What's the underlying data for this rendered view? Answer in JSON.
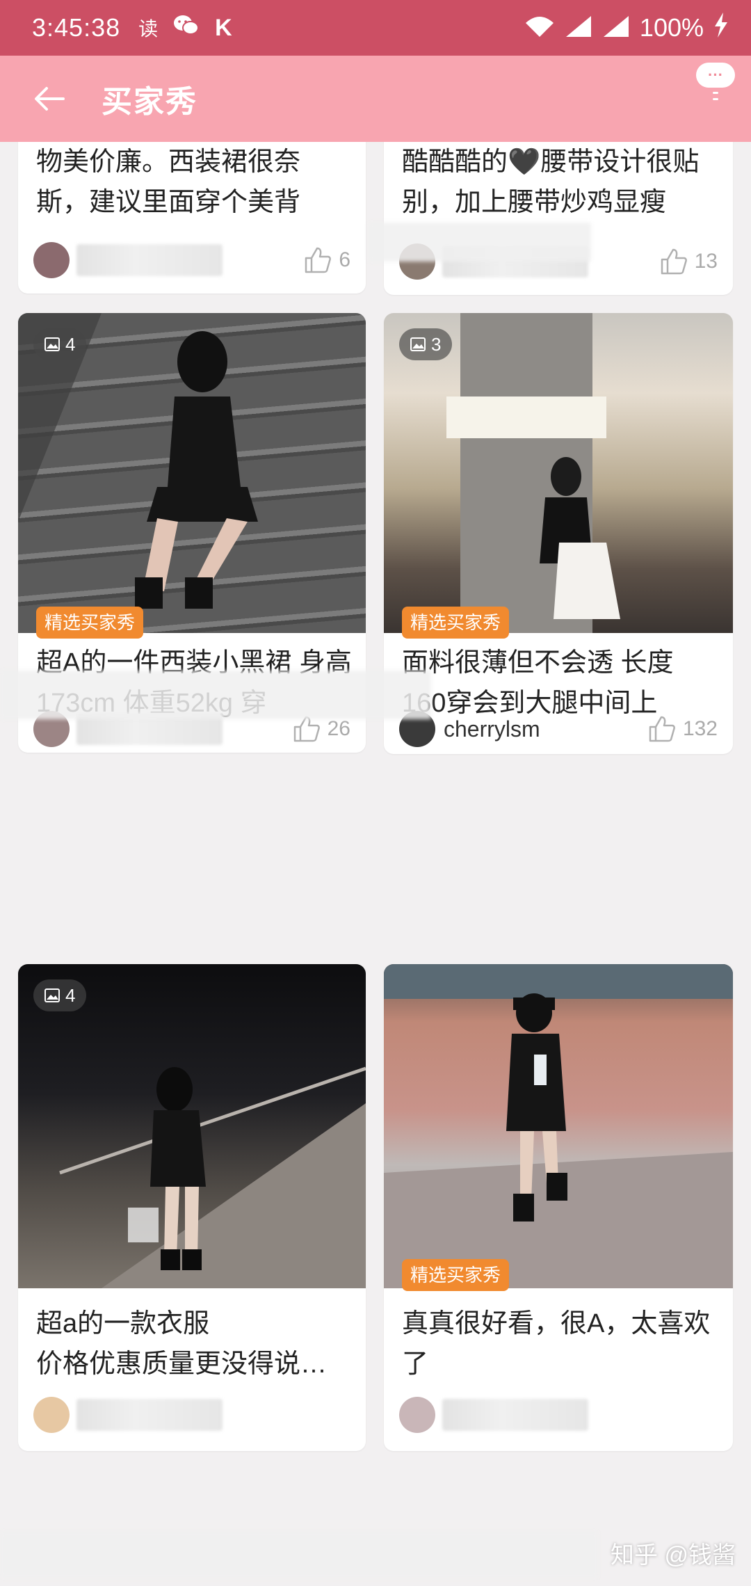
{
  "status_bar": {
    "time": "3:45:38",
    "app_glyph": "读",
    "k_glyph": "K",
    "battery": "100%",
    "icons": [
      "wechat-icon",
      "wifi-icon",
      "signal-icon",
      "charging-icon"
    ]
  },
  "header": {
    "title": "买家秀",
    "more_label": "···"
  },
  "feed": {
    "top_left": {
      "text": "物美价廉。西装裙很奈斯，建议里面穿个美背",
      "likes": "6"
    },
    "top_right": {
      "text": "酷酷酷的🖤腰带设计很贴别，加上腰带炒鸡显瘦",
      "likes": "13"
    },
    "cards": [
      {
        "photo_count": "4",
        "badge": "精选买家秀",
        "text": "超A的一件西装小黑裙  身高173cm  体重52kg 穿",
        "likes": "26"
      },
      {
        "photo_count": "3",
        "badge": "精选买家秀",
        "text": "面料很薄但不会透 长度 160穿会到大腿中间上",
        "author": "cherrylsm",
        "likes": "132"
      },
      {
        "photo_count": "4",
        "text": "超a的一款衣服\n价格优惠质量更没得说…"
      },
      {
        "badge": "精选买家秀",
        "text": "真真很好看，很A，太喜欢了"
      }
    ]
  },
  "watermark": "知乎 @钱酱",
  "colors": {
    "status_bar": "#cc4f64",
    "app_bar": "#f8a5b0",
    "badge": "#f18a2f",
    "background": "#f2f0f1"
  }
}
